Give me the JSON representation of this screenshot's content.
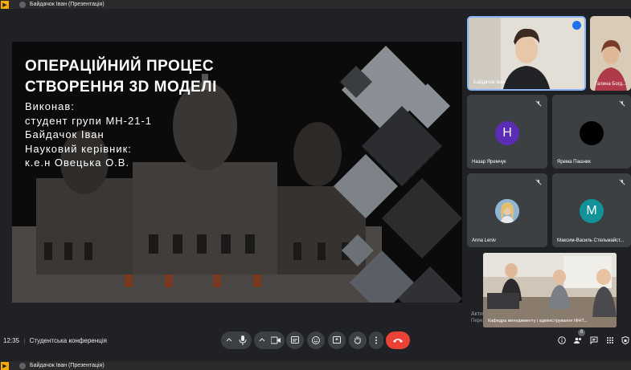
{
  "window": {
    "title": "Байдачок Іван (Презентація)",
    "title_bottom": "Байдачок Іван (Презентація)"
  },
  "slide": {
    "title_line1": "ОПЕРАЦІЙНИЙ ПРОЦЕС",
    "title_line2": "СТВОРЕННЯ 3D МОДЕЛІ",
    "body_lines": [
      "Виконав:",
      "студент групи МН-21-1",
      "Байдачок Іван",
      "Науковий керівник:",
      "к.е.н Овецька О.В."
    ]
  },
  "participants": {
    "main_speaker": "Байдачок Іван",
    "partial": "Галина Богд...",
    "tiles": [
      {
        "name": "Назар Яремчук",
        "initial": "Н",
        "color": "#5b2cb5"
      },
      {
        "name": "Ярема Пашник",
        "initial": "",
        "color": "#000000"
      },
      {
        "name": "Anna Leniv",
        "initial": "",
        "color": "#7ba7c9"
      },
      {
        "name": "Максим-Василь Стельмайст...",
        "initial": "М",
        "color": "#12939a"
      }
    ],
    "room_caption": "Кафедра менеджменту і адміністрування ІФНТ..."
  },
  "active": {
    "label": "Акти...",
    "sub": "Пере..."
  },
  "controls": {
    "time": "12:35",
    "separator": "|",
    "meeting_name": "Студентська конференція",
    "participants_count": "8"
  },
  "colors": {
    "accent": "#8ab4f8",
    "end_call": "#ea4335",
    "tile_bg": "#3c4043"
  }
}
